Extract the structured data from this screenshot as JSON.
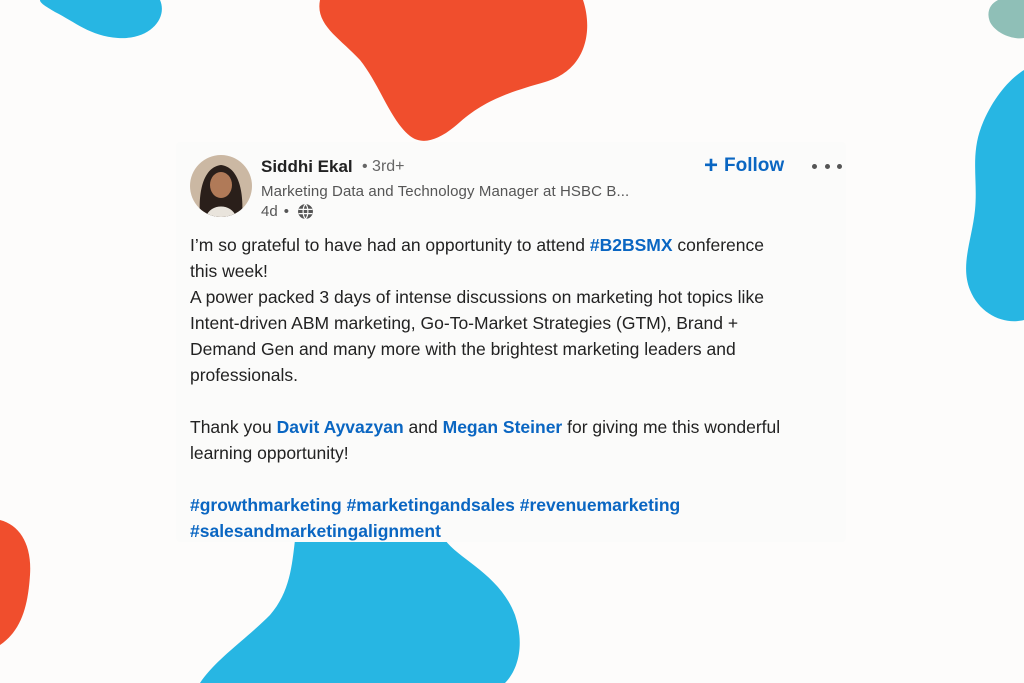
{
  "post": {
    "author_name": "Siddhi Ekal",
    "degree": "• 3rd+",
    "headline": "Marketing Data and Technology Manager at HSBC B...",
    "time": "4d",
    "separator": "•",
    "follow_label": "Follow",
    "follow_icon": "plus-icon",
    "more_icon": "more-options-icon",
    "visibility_icon": "globe-icon",
    "line1_pre": "I’m so grateful to have had an opportunity to attend ",
    "line1_tag": "#B2BSMX",
    "line1_post": " conference",
    "line2": "this week!",
    "line3": "A power packed 3 days of intense discussions on marketing hot topics like",
    "line4": "Intent-driven ABM marketing, Go-To-Market Strategies (GTM), Brand +",
    "line5": "Demand Gen and many more with the brightest marketing leaders and",
    "line6": "professionals.",
    "thanks_pre": "Thank you ",
    "mention1": "Davit Ayvazyan",
    "thanks_and": " and ",
    "mention2": "Megan Steiner",
    "thanks_post": " for giving me this wonderful",
    "thanks_line2": "learning opportunity!",
    "hashtags": [
      "#growthmarketing",
      "#marketingandsales",
      "#revenuemarketing",
      "#salesandmarketingalignment"
    ]
  },
  "colors": {
    "link": "#0a66c2",
    "blob_orange": "#f04e2d",
    "blob_blue": "#27b6e3",
    "blob_teal": "#8fbfb7",
    "background": "#fdfcfb"
  }
}
